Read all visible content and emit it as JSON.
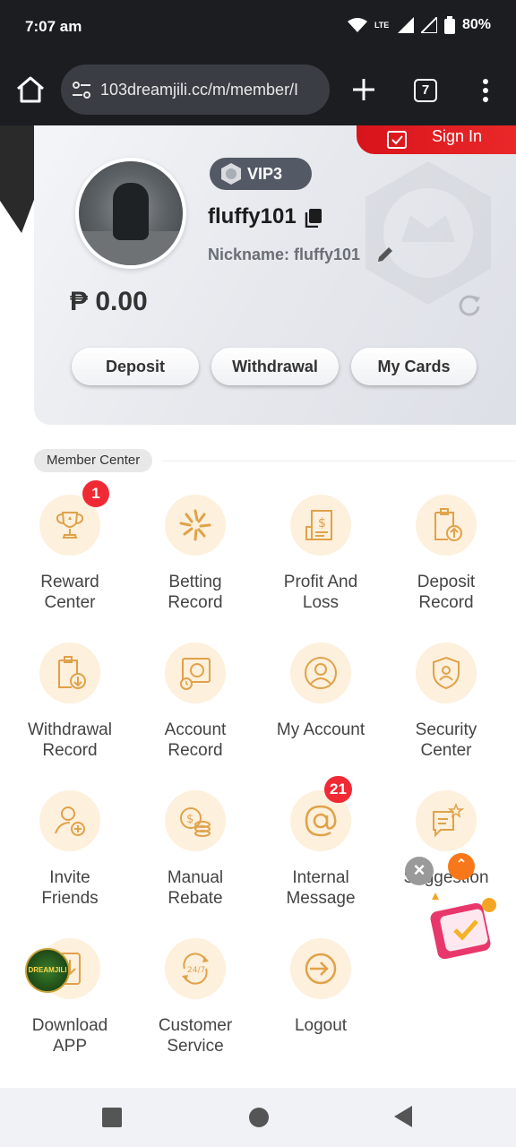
{
  "status_bar": {
    "time": "7:07 am",
    "battery": "80%",
    "network": "LTE"
  },
  "browser": {
    "url": "103dreamjili.cc/m/member/I",
    "tab_count": "7"
  },
  "account": {
    "signin_label": "Sign In",
    "vip_level": "VIP3",
    "username": "fluffy101",
    "nickname": "Nickname: fluffy101",
    "balance": "₱ 0.00",
    "buttons": {
      "deposit": "Deposit",
      "withdrawal": "Withdrawal",
      "my_cards": "My Cards"
    }
  },
  "member_center": {
    "title": "Member Center",
    "items": [
      {
        "label": "Reward Center",
        "icon": "trophy-icon",
        "badge": "1"
      },
      {
        "label": "Betting Record",
        "icon": "star-burst-icon"
      },
      {
        "label": "Profit And Loss",
        "icon": "receipt-dollar-icon"
      },
      {
        "label": "Deposit Record",
        "icon": "clipboard-upload-icon"
      },
      {
        "label": "Withdrawal Record",
        "icon": "clipboard-download-icon"
      },
      {
        "label": "Account Record",
        "icon": "safe-clock-icon"
      },
      {
        "label": "My Account",
        "icon": "user-circle-icon"
      },
      {
        "label": "Security Center",
        "icon": "shield-user-icon"
      },
      {
        "label": "Invite Friends",
        "icon": "user-plus-icon"
      },
      {
        "label": "Manual Rebate",
        "icon": "coin-stack-icon"
      },
      {
        "label": "Internal Message",
        "icon": "at-sign-icon",
        "badge": "21"
      },
      {
        "label": "Suggestion",
        "icon": "chat-star-icon"
      },
      {
        "label": "Download APP",
        "icon": "download-app-icon"
      },
      {
        "label": "Customer Service",
        "icon": "support-24-7-icon"
      },
      {
        "label": "Logout",
        "icon": "logout-icon"
      }
    ]
  },
  "floating": {
    "logo_text": "DREAMJILI",
    "close_symbol": "×",
    "up_symbol": "⌃"
  },
  "colors": {
    "accent": "#e8a64a",
    "icon_bg": "#fdf0dc",
    "badge": "#f02a34",
    "signin": "#d8141b"
  }
}
